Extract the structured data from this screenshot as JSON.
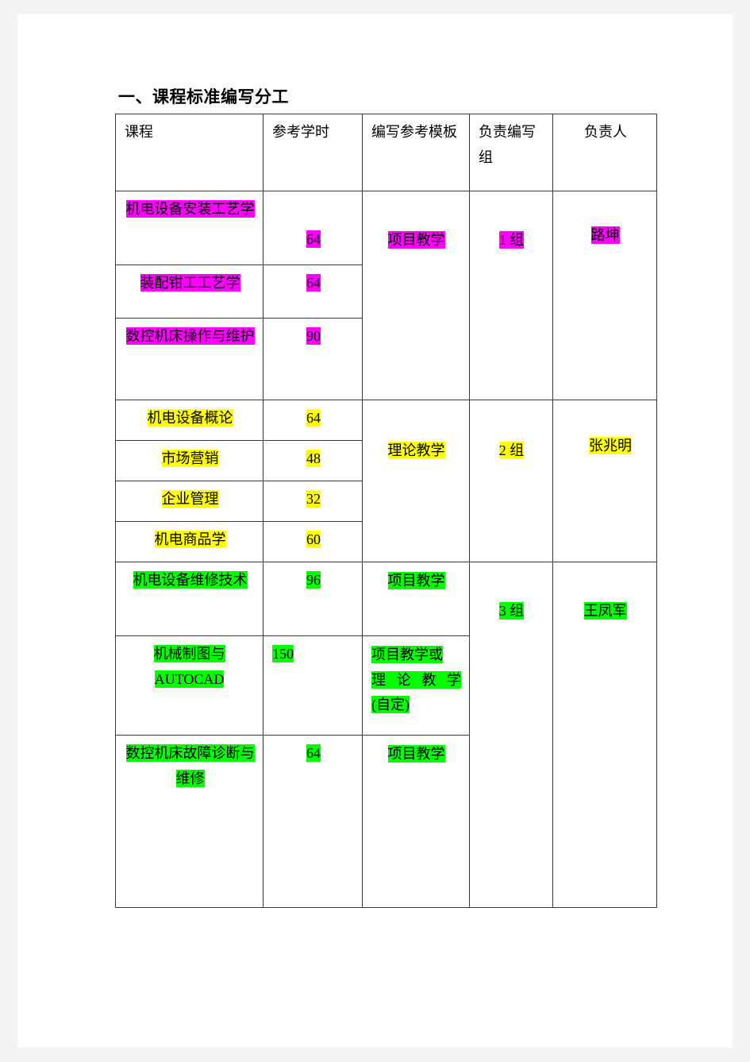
{
  "document": {
    "title": "一、课程标准编写分工"
  },
  "table": {
    "headers": {
      "course": "课程",
      "hours": "参考学时",
      "template": "编写参考模板",
      "group": "负责编写组",
      "leader": "负责人"
    },
    "groups": [
      {
        "color": "#ff00ff",
        "template": "项目教学",
        "group": "1 组",
        "leader": "路坤",
        "rows": [
          {
            "course": "机电设备安装工艺学",
            "hours": "64"
          },
          {
            "course": "装配钳工工艺学",
            "hours": "64"
          },
          {
            "course": "数控机床操作与维护",
            "hours": "90"
          }
        ]
      },
      {
        "color": "#ffff00",
        "template": "理论教学",
        "group": "2 组",
        "leader": "张兆明",
        "rows": [
          {
            "course": "机电设备概论",
            "hours": "64"
          },
          {
            "course": "市场营销",
            "hours": "48"
          },
          {
            "course": "企业管理",
            "hours": "32"
          },
          {
            "course": "机电商品学",
            "hours": "60"
          }
        ]
      },
      {
        "color": "#00ff00",
        "group": "3 组",
        "leader": "王凤军",
        "rows": [
          {
            "course": "机电设备维修技术",
            "hours": "96",
            "template": "项目教学"
          },
          {
            "course": "机械制图与AUTOCAD",
            "hours": "150",
            "template_line1": "项目教学或",
            "template_line2": "理论教学",
            "template_line3": "(自定)"
          },
          {
            "course": "数控机床故障诊断与维修",
            "hours": "64",
            "template": "项目教学"
          }
        ]
      }
    ]
  }
}
